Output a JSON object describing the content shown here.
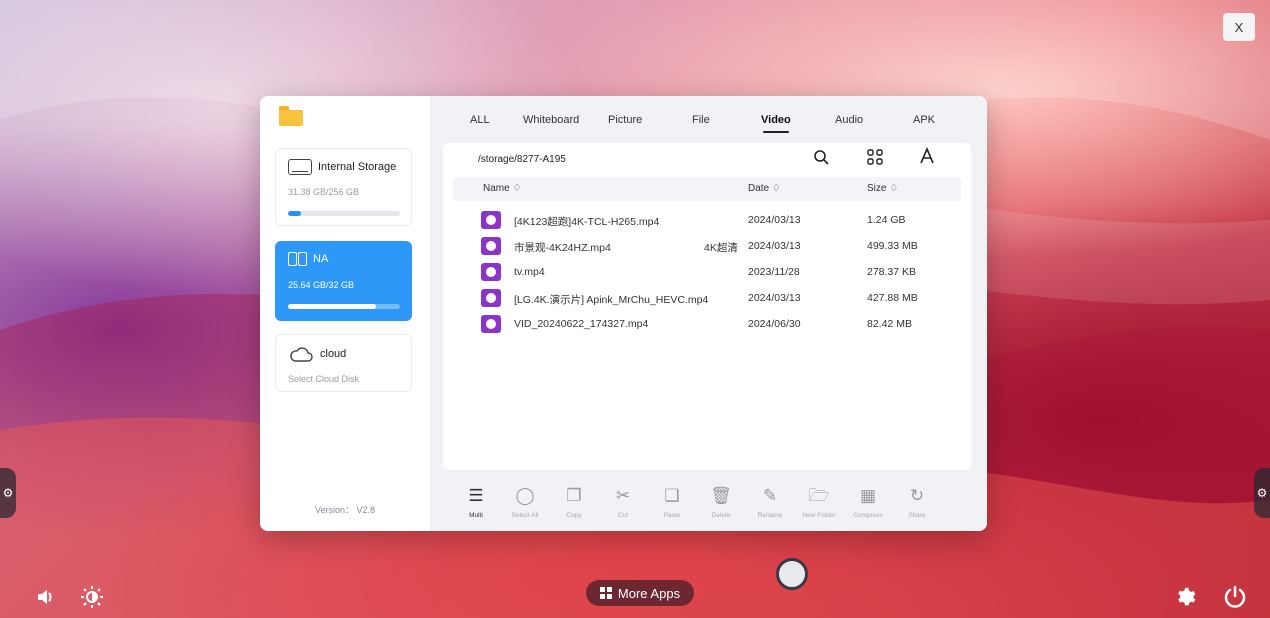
{
  "system": {
    "close_label": "X",
    "more_apps_label": "More Apps"
  },
  "sidebar": {
    "storages": [
      {
        "label": "Internal Storage",
        "usage": "31.38 GB/256 GB",
        "fill": 0.12
      },
      {
        "label": "NA",
        "usage": "25.64 GB/32 GB",
        "fill": 0.79
      },
      {
        "label": "cloud",
        "usage": "Select Cloud Disk"
      }
    ],
    "version": "Version： V2.8"
  },
  "tabs": [
    "ALL",
    "Whiteboard",
    "Picture",
    "File",
    "Video",
    "Audio",
    "APK"
  ],
  "active_tab": "Video",
  "path": "/storage/8277-A195",
  "columns": {
    "name": "Name ♢",
    "date": "Date ♢",
    "size": "Size ♢"
  },
  "files": [
    {
      "name": "[4K123超跑]4K-TCL-H265.mp4",
      "date": "2024/03/13",
      "size": "1.24 GB"
    },
    {
      "name": "市景观-4K24HZ.mp4",
      "date": "2024/03/13",
      "size": "499.33 MB"
    },
    {
      "name": "tv.mp4",
      "date": "2023/11/28",
      "size": "278.37 KB"
    },
    {
      "name": "[LG.4K.演示片] Apink_MrChu_HEVC.mp4",
      "date": "2024/03/13",
      "size": "427.88 MB"
    },
    {
      "name": "VID_20240622_174327.mp4",
      "date": "2024/06/30",
      "size": "82.42 MB"
    }
  ],
  "overlapping_text": "4K超清",
  "toolbar": [
    "Multi",
    "Select All",
    "Copy",
    "Cut",
    "Paste",
    "Delete",
    "Rename",
    "New Folder",
    "Compress",
    "Share"
  ],
  "colors": {
    "accent": "#2d98f7",
    "video_icon": "#8a35c8",
    "folder": "#f7c23e"
  }
}
